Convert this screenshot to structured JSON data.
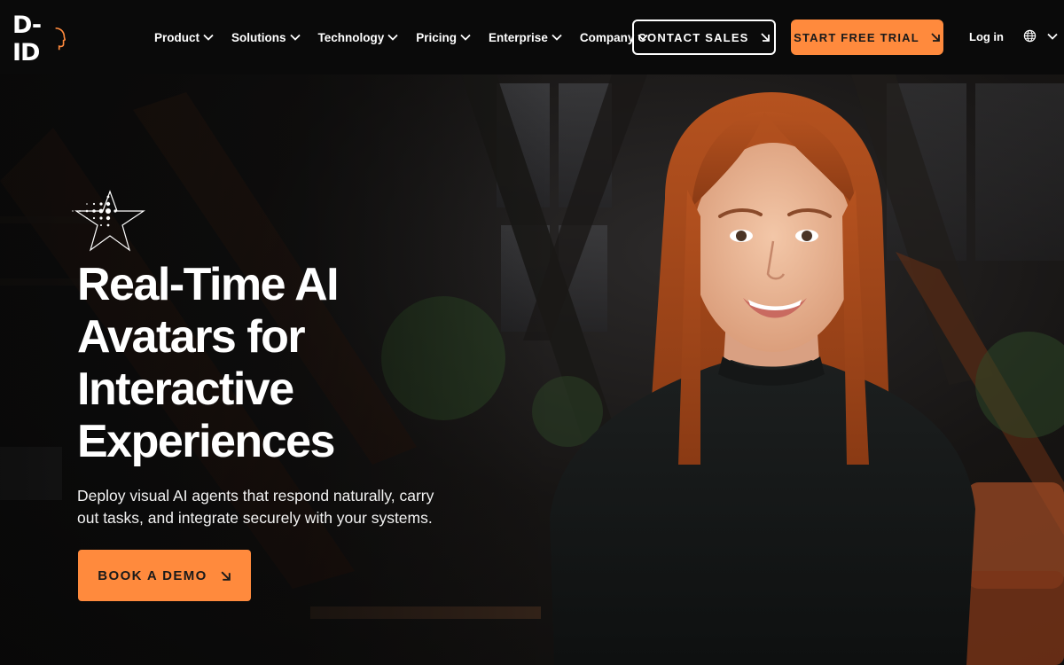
{
  "brand": {
    "logo_text": "D-ID",
    "accent_color": "#ff8a3d"
  },
  "nav": {
    "items": [
      {
        "label": "Product"
      },
      {
        "label": "Solutions"
      },
      {
        "label": "Technology"
      },
      {
        "label": "Pricing"
      },
      {
        "label": "Enterprise"
      },
      {
        "label": "Company"
      }
    ],
    "contact_sales": "CONTACT SALES",
    "start_trial": "START FREE TRIAL",
    "login": "Log in",
    "language_icon": "globe-icon"
  },
  "hero": {
    "title_lines": [
      "Real-Time AI",
      "Avatars for",
      "Interactive",
      "Experiences"
    ],
    "subtitle": "Deploy visual AI agents that respond naturally, carry out tasks, and integrate securely with your systems.",
    "cta": "BOOK A DEMO",
    "avatar_description_icon": "ai-avatar-woman"
  }
}
